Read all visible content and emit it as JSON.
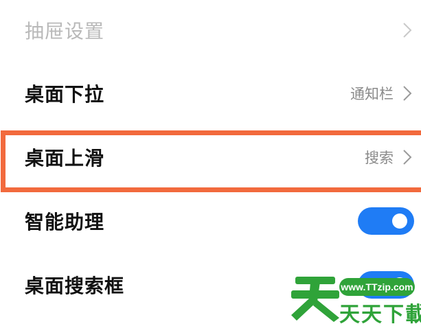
{
  "settings": {
    "rows": [
      {
        "label": "抽屉设置",
        "value": ""
      },
      {
        "label": "桌面下拉",
        "value": "通知栏"
      },
      {
        "label": "桌面上滑",
        "value": "搜索"
      },
      {
        "label": "智能助理",
        "toggle_on": true
      },
      {
        "label": "桌面搜索框",
        "toggle_on": true
      }
    ]
  },
  "watermark": {
    "glyph": "天",
    "url": "www.TTzip.com",
    "name": "天天下載"
  },
  "colors": {
    "toggle_on": "#1f7cf5",
    "highlight_border": "#f26a3d",
    "watermark_green": "#2fa339",
    "label_text": "#111111",
    "disabled_text": "#b9b9b9",
    "value_text": "#8a8a8a"
  },
  "icons": {
    "chevron": "chevron-right-icon",
    "watermark_logo": "tian-glyph-logo"
  }
}
